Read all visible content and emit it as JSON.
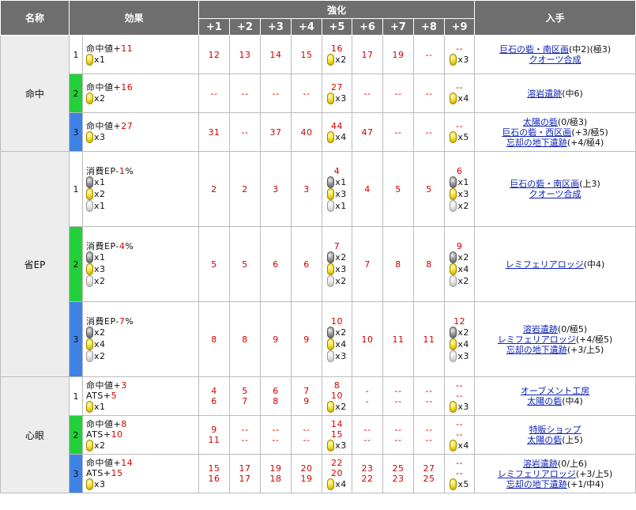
{
  "header": {
    "name": "名称",
    "effect": "効果",
    "enhance": "強化",
    "obtain": "入手",
    "levels": [
      "+1",
      "+2",
      "+3",
      "+4",
      "+5",
      "+6",
      "+7",
      "+8",
      "+9"
    ]
  },
  "groups": [
    {
      "name": "命中",
      "rows": [
        {
          "lv": "1",
          "color": "white",
          "effect": [
            {
              "label": "命中値+",
              "value": "11"
            }
          ],
          "cost": [
            {
              "orb": "gold",
              "qty": "x1"
            }
          ],
          "vals": [
            [
              "12"
            ],
            [
              "13"
            ],
            [
              "14"
            ],
            [
              "15"
            ],
            [
              "16"
            ],
            [
              "17"
            ],
            [
              "19"
            ],
            [
              "--"
            ],
            [
              "--"
            ]
          ],
          "p5_cost": [
            {
              "orb": "gold",
              "qty": "x2"
            }
          ],
          "p9_cost": [
            {
              "orb": "gold",
              "qty": "x3"
            }
          ],
          "obtain": [
            {
              "link": "巨石の砦・南区画",
              "note": "(中2)(極3)"
            },
            {
              "link": "クオーツ合成",
              "note": ""
            }
          ]
        },
        {
          "lv": "2",
          "color": "green",
          "effect": [
            {
              "label": "命中値+",
              "value": "16"
            }
          ],
          "cost": [
            {
              "orb": "gold",
              "qty": "x2"
            }
          ],
          "vals": [
            [
              "--"
            ],
            [
              "--"
            ],
            [
              "--"
            ],
            [
              "--"
            ],
            [
              "27"
            ],
            [
              "--"
            ],
            [
              "--"
            ],
            [
              "--"
            ],
            [
              "--"
            ]
          ],
          "p5_cost": [
            {
              "orb": "gold",
              "qty": "x3"
            }
          ],
          "p9_cost": [
            {
              "orb": "gold",
              "qty": "x4"
            }
          ],
          "obtain": [
            {
              "link": "溶岩遺跡",
              "note": "(中6)"
            }
          ]
        },
        {
          "lv": "3",
          "color": "blue",
          "effect": [
            {
              "label": "命中値+",
              "value": "27"
            }
          ],
          "cost": [
            {
              "orb": "gold",
              "qty": "x3"
            }
          ],
          "vals": [
            [
              "31"
            ],
            [
              "--"
            ],
            [
              "37"
            ],
            [
              "40"
            ],
            [
              "44"
            ],
            [
              "47"
            ],
            [
              "--"
            ],
            [
              "--"
            ],
            [
              "--"
            ]
          ],
          "p5_cost": [
            {
              "orb": "gold",
              "qty": "x4"
            }
          ],
          "p9_cost": [
            {
              "orb": "gold",
              "qty": "x5"
            }
          ],
          "obtain": [
            {
              "link": "太陽の砦",
              "note": "(0/極3)"
            },
            {
              "link": "巨石の砦・西区画",
              "note": "(+3/極5)"
            },
            {
              "link": "忘却の地下遺跡",
              "note": "(+4/極4)"
            }
          ]
        }
      ]
    },
    {
      "name": "省EP",
      "rows": [
        {
          "lv": "1",
          "color": "white",
          "effect": [
            {
              "label": "消費EP-",
              "value": "1",
              "suffix": "%"
            }
          ],
          "cost": [
            {
              "orb": "dark",
              "qty": "x1"
            },
            {
              "orb": "gold",
              "qty": "x2"
            },
            {
              "orb": "light",
              "qty": "x1"
            }
          ],
          "vals": [
            [
              "2"
            ],
            [
              "2"
            ],
            [
              "3"
            ],
            [
              "3"
            ],
            [
              "4"
            ],
            [
              "4"
            ],
            [
              "5"
            ],
            [
              "5"
            ],
            [
              "6"
            ]
          ],
          "p5_cost": [
            {
              "orb": "dark",
              "qty": "x1"
            },
            {
              "orb": "gold",
              "qty": "x3"
            },
            {
              "orb": "light",
              "qty": "x1"
            }
          ],
          "p9_cost": [
            {
              "orb": "dark",
              "qty": "x1"
            },
            {
              "orb": "gold",
              "qty": "x3"
            },
            {
              "orb": "light",
              "qty": "x2"
            }
          ],
          "obtain": [
            {
              "link": "巨石の砦・南区画",
              "note": "(上3)"
            },
            {
              "link": "クオーツ合成",
              "note": ""
            }
          ]
        },
        {
          "lv": "2",
          "color": "green",
          "effect": [
            {
              "label": "消費EP-",
              "value": "4",
              "suffix": "%"
            }
          ],
          "cost": [
            {
              "orb": "dark",
              "qty": "x1"
            },
            {
              "orb": "gold",
              "qty": "x3"
            },
            {
              "orb": "light",
              "qty": "x2"
            }
          ],
          "vals": [
            [
              "5"
            ],
            [
              "5"
            ],
            [
              "6"
            ],
            [
              "6"
            ],
            [
              "7"
            ],
            [
              "7"
            ],
            [
              "8"
            ],
            [
              "8"
            ],
            [
              "9"
            ]
          ],
          "p5_cost": [
            {
              "orb": "dark",
              "qty": "x2"
            },
            {
              "orb": "gold",
              "qty": "x3"
            },
            {
              "orb": "light",
              "qty": "x2"
            }
          ],
          "p9_cost": [
            {
              "orb": "dark",
              "qty": "x2"
            },
            {
              "orb": "gold",
              "qty": "x4"
            },
            {
              "orb": "light",
              "qty": "x2"
            }
          ],
          "obtain": [
            {
              "link": "レミフェリアロッジ",
              "note": "(中4)"
            }
          ]
        },
        {
          "lv": "3",
          "color": "blue",
          "effect": [
            {
              "label": "消費EP-",
              "value": "7",
              "suffix": "%"
            }
          ],
          "cost": [
            {
              "orb": "dark",
              "qty": "x2"
            },
            {
              "orb": "gold",
              "qty": "x4"
            },
            {
              "orb": "light",
              "qty": "x2"
            }
          ],
          "vals": [
            [
              "8"
            ],
            [
              "8"
            ],
            [
              "9"
            ],
            [
              "9"
            ],
            [
              "10"
            ],
            [
              "10"
            ],
            [
              "11"
            ],
            [
              "11"
            ],
            [
              "12"
            ]
          ],
          "p5_cost": [
            {
              "orb": "dark",
              "qty": "x2"
            },
            {
              "orb": "gold",
              "qty": "x4"
            },
            {
              "orb": "light",
              "qty": "x3"
            }
          ],
          "p9_cost": [
            {
              "orb": "dark",
              "qty": "x2"
            },
            {
              "orb": "gold",
              "qty": "x4"
            },
            {
              "orb": "light",
              "qty": "x3"
            }
          ],
          "obtain": [
            {
              "link": "溶岩遺跡",
              "note": "(0/極5)"
            },
            {
              "link": "レミフェリアロッジ",
              "note": "(+4/極5)"
            },
            {
              "link": "忘却の地下遺跡",
              "note": "(+3/上5)"
            }
          ]
        }
      ]
    },
    {
      "name": "心眼",
      "rows": [
        {
          "lv": "1",
          "color": "white",
          "effect": [
            {
              "label": "命中値+",
              "value": "3"
            },
            {
              "label": "ATS+",
              "value": "5"
            }
          ],
          "cost": [
            {
              "orb": "gold",
              "qty": "x1"
            }
          ],
          "vals": [
            [
              "4",
              "6"
            ],
            [
              "5",
              "7"
            ],
            [
              "6",
              "8"
            ],
            [
              "7",
              "9"
            ],
            [
              "8",
              "10"
            ],
            [
              "-",
              "-"
            ],
            [
              "--",
              "--"
            ],
            [
              "--",
              "--"
            ],
            [
              "--",
              "--"
            ]
          ],
          "p5_cost": [
            {
              "orb": "gold",
              "qty": "x2"
            }
          ],
          "p9_cost": [
            {
              "orb": "gold",
              "qty": "x3"
            }
          ],
          "obtain": [
            {
              "link": "オーブメント工房",
              "note": ""
            },
            {
              "link": "太陽の砦",
              "note": "(中4)"
            }
          ]
        },
        {
          "lv": "2",
          "color": "green",
          "effect": [
            {
              "label": "命中値+",
              "value": "8"
            },
            {
              "label": "ATS+",
              "value": "10"
            }
          ],
          "cost": [
            {
              "orb": "gold",
              "qty": "x2"
            }
          ],
          "vals": [
            [
              "9",
              "11"
            ],
            [
              "--",
              "--"
            ],
            [
              "--",
              "--"
            ],
            [
              "--",
              "--"
            ],
            [
              "14",
              "15"
            ],
            [
              "--",
              "--"
            ],
            [
              "--",
              "--"
            ],
            [
              "--",
              "--"
            ],
            [
              "--",
              "--"
            ]
          ],
          "p5_cost": [
            {
              "orb": "gold",
              "qty": "x3"
            }
          ],
          "p9_cost": [
            {
              "orb": "gold",
              "qty": "x4"
            }
          ],
          "obtain": [
            {
              "link": "特販ショップ",
              "note": ""
            },
            {
              "link": "太陽の砦",
              "note": "(上5)"
            }
          ]
        },
        {
          "lv": "3",
          "color": "blue",
          "effect": [
            {
              "label": "命中値+",
              "value": "14"
            },
            {
              "label": "ATS+",
              "value": "15"
            }
          ],
          "cost": [
            {
              "orb": "gold",
              "qty": "x3"
            }
          ],
          "vals": [
            [
              "15",
              "16"
            ],
            [
              "17",
              "17"
            ],
            [
              "19",
              "18"
            ],
            [
              "20",
              "19"
            ],
            [
              "22",
              "20"
            ],
            [
              "23",
              "22"
            ],
            [
              "25",
              "23"
            ],
            [
              "27",
              "25"
            ],
            [
              "--",
              "--"
            ]
          ],
          "p5_cost": [
            {
              "orb": "gold",
              "qty": "x4"
            }
          ],
          "p9_cost": [
            {
              "orb": "gold",
              "qty": "x5"
            }
          ],
          "obtain": [
            {
              "link": "溶岩遺跡",
              "note": "(0/上6)"
            },
            {
              "link": "レミフェリアロッジ",
              "note": "(+3/上5)"
            },
            {
              "link": "忘却の地下遺跡",
              "note": "(+1/中4)"
            }
          ]
        }
      ]
    }
  ]
}
